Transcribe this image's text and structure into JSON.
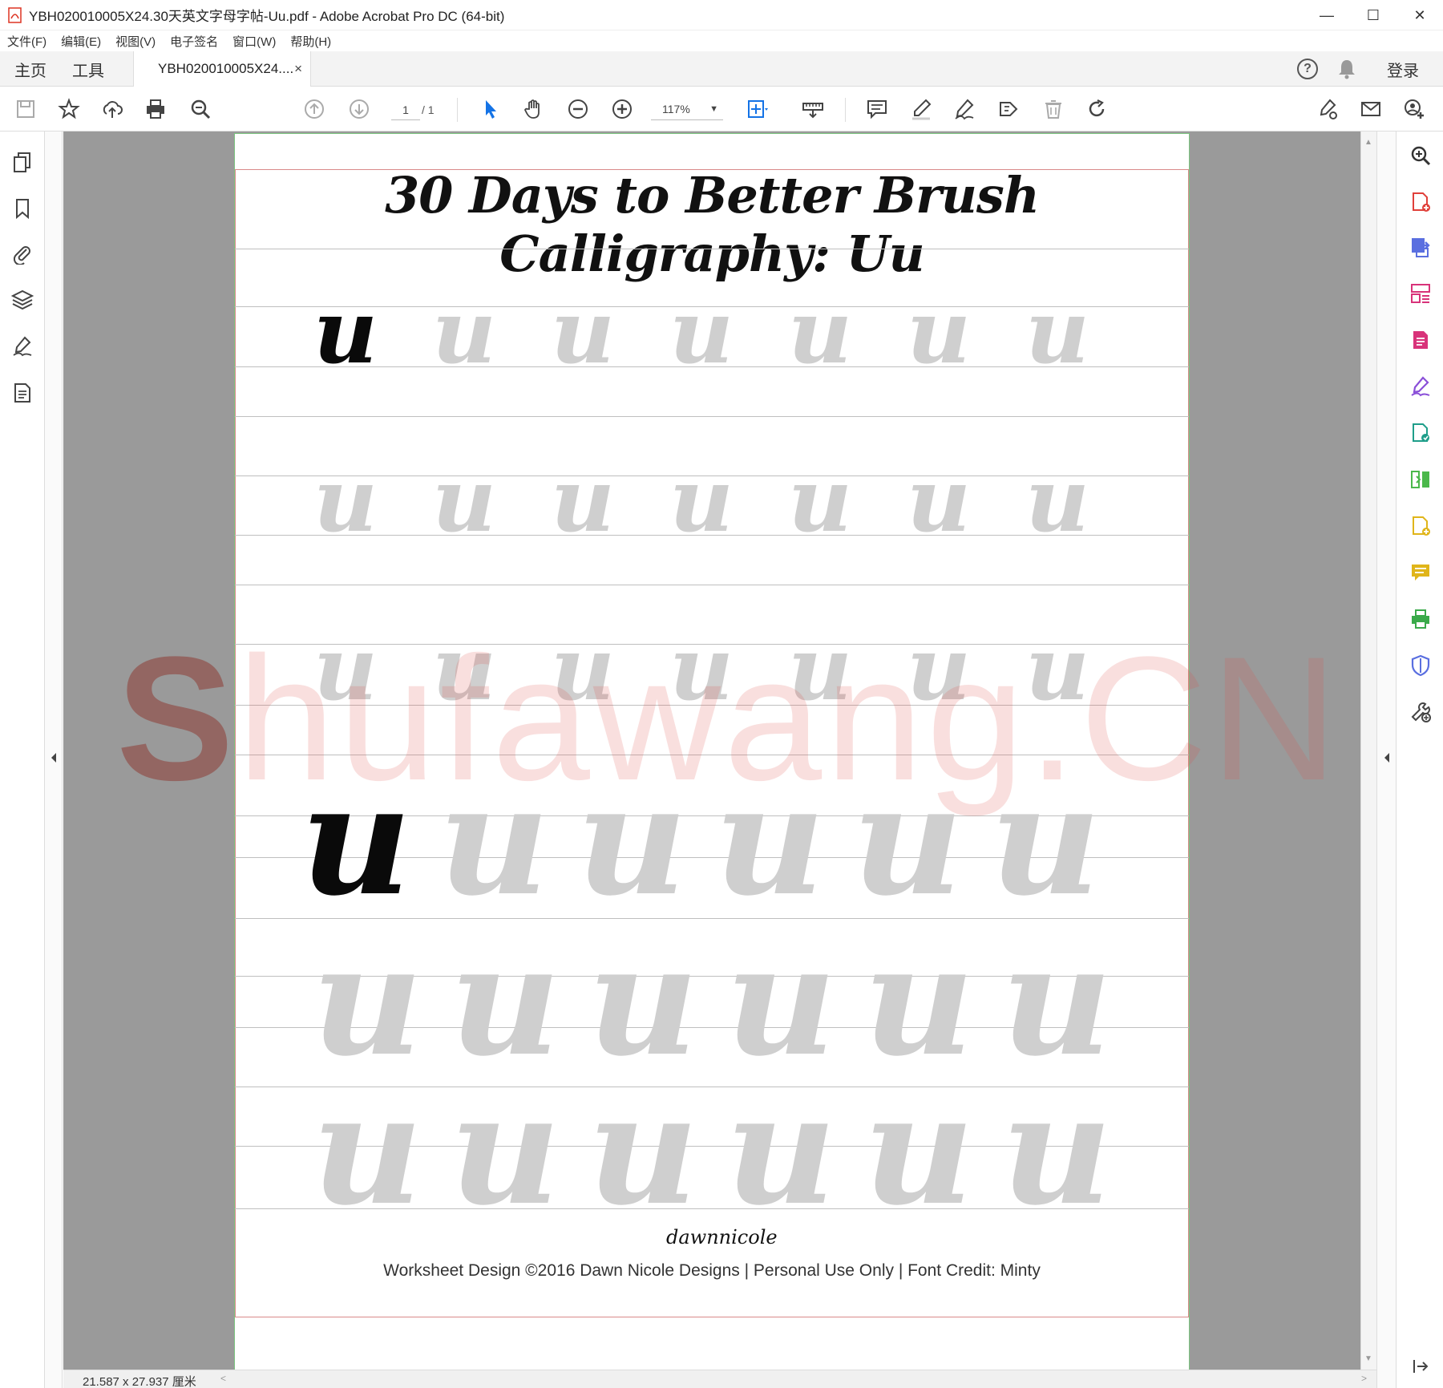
{
  "window": {
    "title": "YBH020010005X24.30天英文字母字帖-Uu.pdf - Adobe Acrobat Pro DC (64-bit)",
    "controls": {
      "minimize": "—",
      "maximize": "☐",
      "close": "✕"
    }
  },
  "menu": [
    "文件(F)",
    "编辑(E)",
    "视图(V)",
    "电子签名",
    "窗口(W)",
    "帮助(H)"
  ],
  "tabs": {
    "home": "主页",
    "tools": "工具",
    "document": "YBH020010005X24....",
    "close": "×"
  },
  "header_right": {
    "help": "?",
    "login": "登录"
  },
  "toolbar": {
    "page_current": "1",
    "page_total": "/ 1",
    "zoom": "117%",
    "zoom_caret": "▼"
  },
  "document": {
    "title": "30 Days to Better Brush Calligraphy: Uu",
    "letter": "u",
    "brand": "dawnnicole",
    "credit": "Worksheet Design ©2016 Dawn Nicole Designs | Personal Use Only | Font Credit: Minty"
  },
  "watermark": {
    "first": "S",
    "rest": "hufawang.CN"
  },
  "status": {
    "page_size": "21.587 x 27.937 厘米"
  },
  "arrows": {
    "left": "◀",
    "right": "◀",
    "up": "▲",
    "down": "▼",
    "h_left": "<",
    "h_right": ">"
  }
}
